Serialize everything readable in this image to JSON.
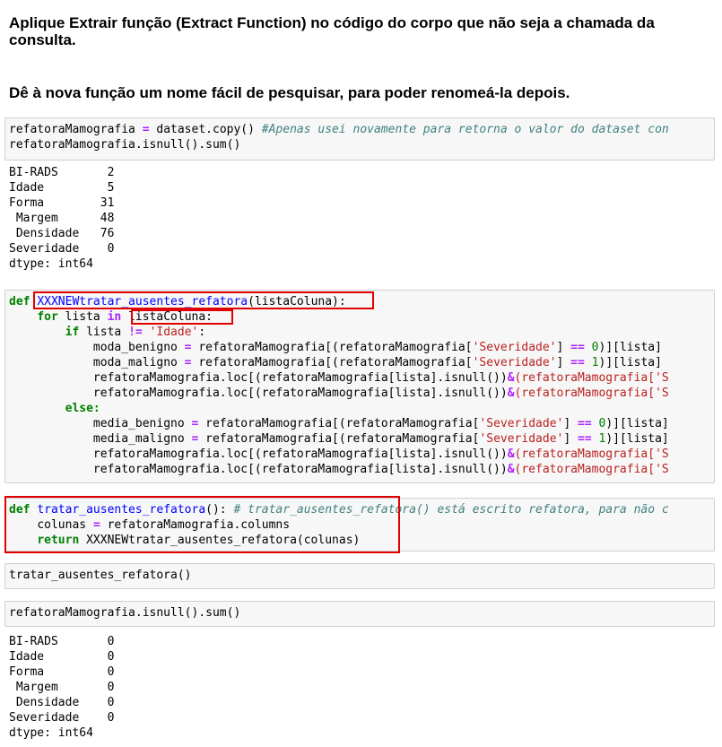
{
  "instructions": {
    "heading1": "Aplique Extrair função (Extract Function) no código do corpo que não seja a chamada da consulta.",
    "heading2": "Dê à nova função um nome fácil de pesquisar, para poder renomeá-la depois."
  },
  "cell1": {
    "line1_var": "refatoraMamografia",
    "line1_eq": " = ",
    "line1_call": "dataset.copy() ",
    "line1_comment": "#Apenas usei novamente para retorna o valor do dataset con",
    "line2": "refatoraMamografia.isnull().sum()"
  },
  "output1": {
    "rows": [
      "BI-RADS       2",
      "Idade         5",
      "Forma        31",
      " Margem      48",
      " Densidade   76",
      "Severidade    0",
      "dtype: int64"
    ]
  },
  "cell2": {
    "def": "def",
    "func_name": "XXXNEWtratar_ausentes_refatora",
    "params": "(listaColuna):",
    "for_kw": "for",
    "for_var": " lista ",
    "in_kw": "in",
    "for_iter": " listaColuna:",
    "if_kw": "if",
    "if_var": " lista ",
    "if_op": "!=",
    "if_str": "'Idade'",
    "else_kw": "else:",
    "moda_benigno": "moda_benigno",
    "moda_maligno": "moda_maligno",
    "media_benigno": "media_benigno",
    "media_maligno": "media_maligno",
    "df": "refatoraMamografia",
    "sev_str": "'Severidade'",
    "zero": "0",
    "one": "1",
    "lista_tail": "][lista]",
    "loc_line": "refatoraMamografia.loc[(refatoraMamografia[lista].isnull())",
    "amp": "&",
    "loc_tail": "(refatoraMamografia['S"
  },
  "cell3": {
    "def": "def",
    "func_name": "tratar_ausentes_refatora",
    "sig_tail": "(): ",
    "comment": "# tratar_ausentes_refatora() está escrito refatora, para não c",
    "colunas": "colunas",
    "colunas_rhs": "refatoraMamografia.columns",
    "return_kw": "return",
    "return_rhs": " XXXNEWtratar_ausentes_refatora(colunas)"
  },
  "cell4": {
    "line": "tratar_ausentes_refatora()"
  },
  "cell5": {
    "line": "refatoraMamografia.isnull().sum()"
  },
  "output2": {
    "rows": [
      "BI-RADS       0",
      "Idade         0",
      "Forma         0",
      " Margem       0",
      " Densidade    0",
      "Severidade    0",
      "dtype: int64"
    ]
  },
  "colors": {
    "highlight": "#e00000",
    "keyword": "#008000",
    "function": "#0000ff",
    "string": "#ba2121",
    "comment": "#408080",
    "operator": "#aa22ff"
  }
}
